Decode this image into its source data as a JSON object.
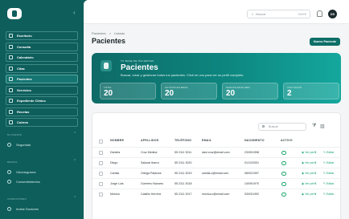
{
  "sidebar": {
    "collapse_icon": "chevron-left-icon",
    "items": [
      {
        "label": "Escritorio",
        "icon": "home-icon"
      },
      {
        "label": "Consulta",
        "icon": "stethoscope-icon"
      },
      {
        "label": "Calendario",
        "icon": "calendar-icon"
      },
      {
        "label": "Citas",
        "icon": "clipboard-icon"
      },
      {
        "label": "Pacientes",
        "icon": "users-icon"
      },
      {
        "label": "Servicios",
        "icon": "briefcase-icon"
      },
      {
        "label": "Expediente Clínico",
        "icon": "folder-icon"
      },
      {
        "label": "Recetas",
        "icon": "prescription-icon"
      },
      {
        "label": "Cobros",
        "icon": "wallet-icon"
      }
    ],
    "active_index": 4,
    "sections": [
      {
        "label": "MI CUENTA",
        "items": [
          "Seguridad"
        ]
      },
      {
        "label": "DENTAL",
        "items": [
          "Odontograma",
          "Consentimientos"
        ]
      },
      {
        "label": "CONSULTORIO",
        "items": [
          "Invitar Doctores"
        ]
      }
    ]
  },
  "topbar": {
    "search_placeholder": "Buscar",
    "search_shortcut": "Ctrl+K",
    "avatar_initials": "DS"
  },
  "breadcrumb": {
    "root": "Pacientes",
    "separator": ">",
    "current": "Listado"
  },
  "page_title": "Pacientes",
  "new_button_label": "Nuevo Paciente",
  "banner": {
    "eyebrow": "TU BASE DE PACIENTES",
    "title": "Pacientes",
    "subtitle": "Buscar, crear y gestionar todos tus pacientes. Click en uno para ver su perfil completo.",
    "stats": [
      {
        "label": "TOTAL",
        "value": "20"
      },
      {
        "label": "ACTIVOS EN MESA",
        "value": "20"
      },
      {
        "label": "NUEVOS ESTE MES",
        "value": "20"
      },
      {
        "label": "CON SALDO",
        "value": "2"
      }
    ]
  },
  "table": {
    "search_placeholder": "Buscar",
    "columns": [
      "NOMBRE",
      "APELLIDOS",
      "TELÉFONO",
      "EMAIL",
      "NACIMIENTO",
      "ACTIVO"
    ],
    "view_label": "Ver perfil",
    "edit_label": "Editar",
    "rows": [
      {
        "nombre": "Daniela",
        "apellidos": "Cruz Medina",
        "telefono": "55 2111 3011",
        "email": "dani.cruz@email.com",
        "nacimiento": "23/05/1998"
      },
      {
        "nombre": "Diego",
        "apellidos": "Salazar Ibarra",
        "telefono": "55 2111 3020",
        "email": "",
        "nacimiento": "01/12/2001"
      },
      {
        "nombre": "Camila",
        "apellidos": "Ortega Palacios",
        "telefono": "55 2111 3019",
        "email": "camila.o@email.com",
        "nacimiento": "08/02/1997"
      },
      {
        "nombre": "Jorge Luis",
        "apellidos": "Guerrero Navarro",
        "telefono": "55 2111 3018",
        "email": "",
        "nacimiento": "14/09/1970"
      },
      {
        "nombre": "Mónica",
        "apellidos": "Castillo Herrera",
        "telefono": "55 2111 3017",
        "email": "monica.c@email.com",
        "nacimiento": "03/03/1992"
      }
    ]
  },
  "colors": {
    "brand": "#0e5e5c",
    "accent": "#0e6e68",
    "active": "#1aa36b"
  }
}
